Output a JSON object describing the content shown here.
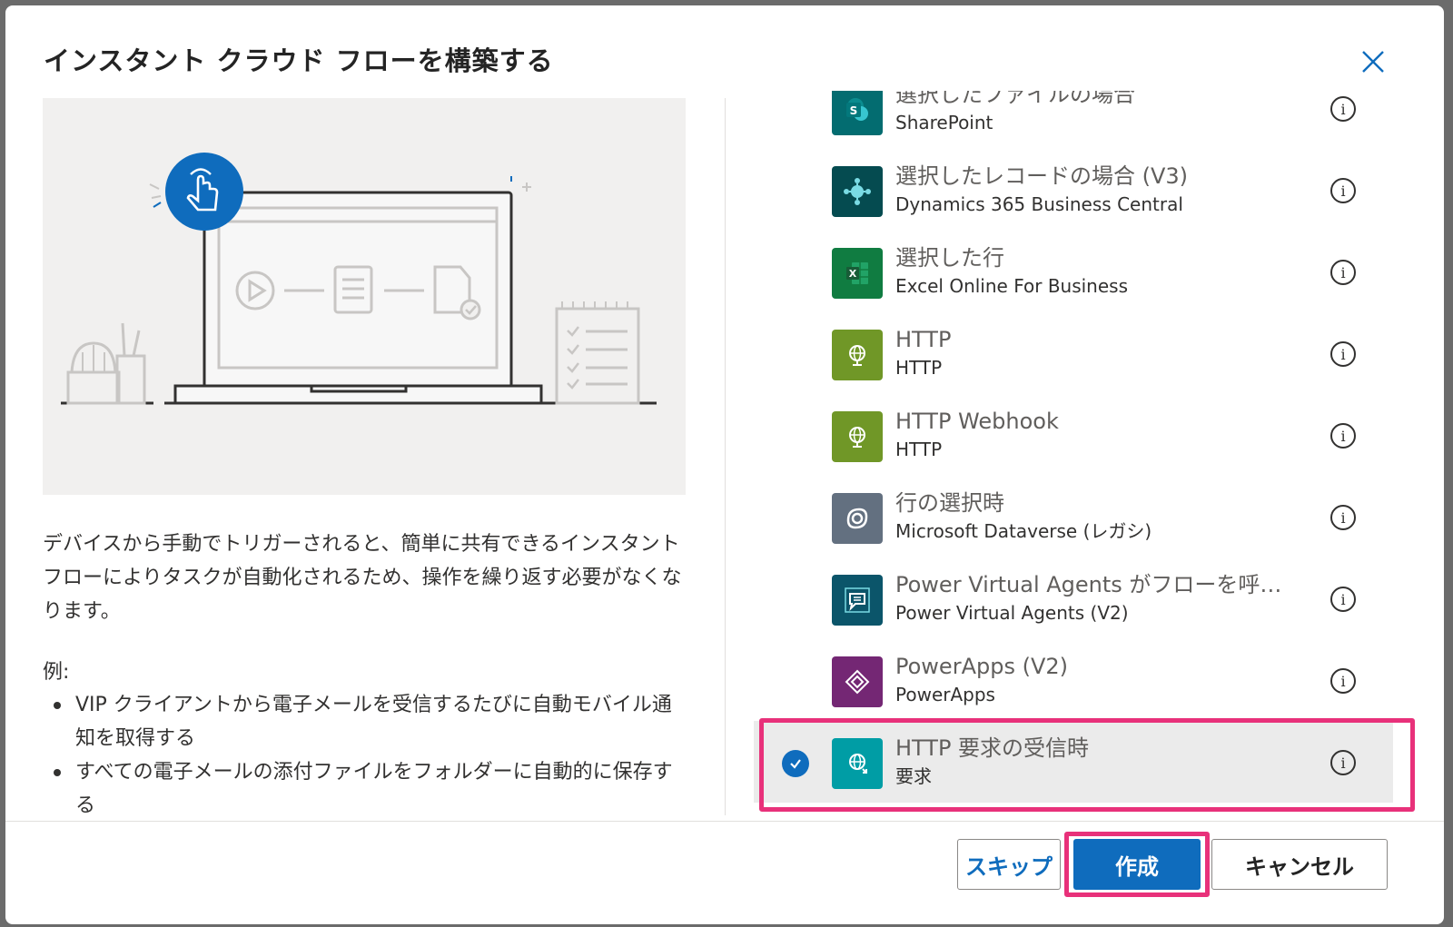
{
  "dialog": {
    "title": "インスタント クラウド フローを構築する",
    "close_icon": "close-icon"
  },
  "description": "デバイスから手動でトリガーされると、簡単に共有できるインスタント フローによりタスクが自動化されるため、操作を繰り返す必要がなくなります。",
  "examples": {
    "label": "例:",
    "items": [
      "VIP クライアントから電子メールを受信するたびに自動モバイル通知を取得する",
      "すべての電子メールの添付ファイルをフォルダーに自動的に保存する"
    ]
  },
  "triggers": [
    {
      "name": "選択したファイルの場合",
      "connector": "SharePoint",
      "color": "#036c70",
      "icon": "sharepoint-icon",
      "selected": false
    },
    {
      "name": "選択したレコードの場合 (V3)",
      "connector": "Dynamics 365 Business Central",
      "color": "#054b50",
      "icon": "dynamics-icon",
      "selected": false
    },
    {
      "name": "選択した行",
      "connector": "Excel Online For Business",
      "color": "#107c41",
      "icon": "excel-icon",
      "selected": false
    },
    {
      "name": "HTTP",
      "connector": "HTTP",
      "color": "#709727",
      "icon": "globe-icon",
      "selected": false
    },
    {
      "name": "HTTP Webhook",
      "connector": "HTTP",
      "color": "#709727",
      "icon": "globe-icon",
      "selected": false
    },
    {
      "name": "行の選択時",
      "connector": "Microsoft Dataverse (レガシ)",
      "color": "#637080",
      "icon": "dataverse-icon",
      "selected": false
    },
    {
      "name": "Power Virtual Agents がフローを呼び...",
      "connector": "Power Virtual Agents (V2)",
      "color": "#0b556a",
      "icon": "chat-icon",
      "selected": false
    },
    {
      "name": "PowerApps (V2)",
      "connector": "PowerApps",
      "color": "#742774",
      "icon": "powerapps-icon",
      "selected": false
    },
    {
      "name": "HTTP 要求の受信時",
      "connector": "要求",
      "color": "#009da5",
      "icon": "request-icon",
      "selected": true
    }
  ],
  "buttons": {
    "skip": "スキップ",
    "create": "作成",
    "cancel": "キャンセル"
  },
  "colors": {
    "accent": "#0f6cbd",
    "highlight": "#e8317a"
  }
}
